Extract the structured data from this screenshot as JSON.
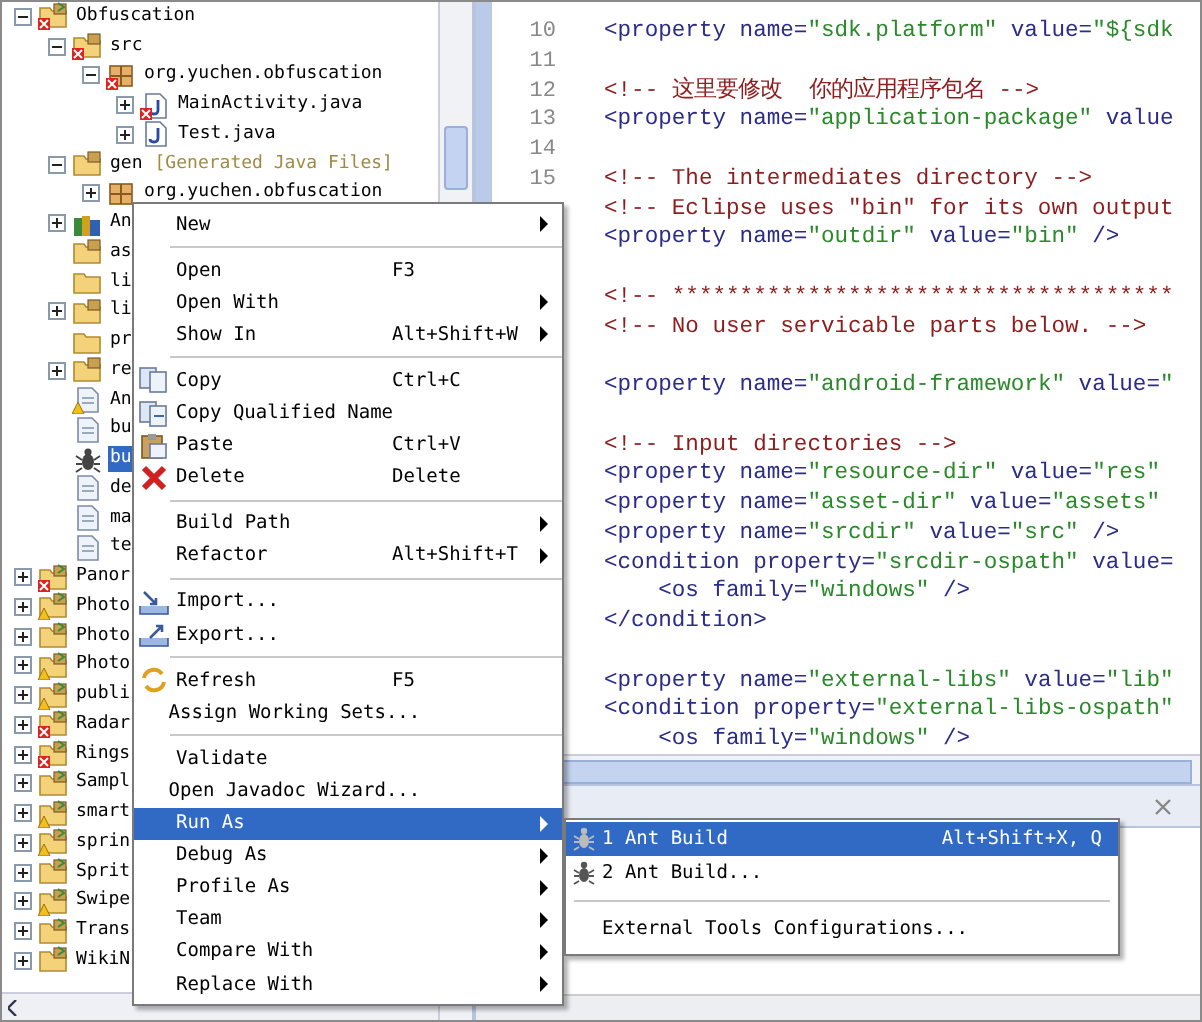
{
  "tree": [
    {
      "label": "Obfuscation",
      "kind": "project",
      "error": true,
      "warning": false,
      "selected": false,
      "expanded": true,
      "children": [
        {
          "label": "src",
          "kind": "source-folder",
          "error": true,
          "warning": false,
          "selected": false,
          "expanded": true,
          "children": [
            {
              "label": "org.yuchen.obfuscation",
              "kind": "package",
              "error": true,
              "warning": false,
              "selected": false,
              "expanded": true,
              "children": [
                {
                  "label": "MainActivity.java",
                  "kind": "java",
                  "error": true,
                  "warning": false,
                  "selected": false,
                  "expanded": false
                },
                {
                  "label": "Test.java",
                  "kind": "java",
                  "error": false,
                  "warning": false,
                  "selected": false,
                  "expanded": false
                }
              ]
            }
          ]
        },
        {
          "label": "gen",
          "decoration": "[Generated Java Files]",
          "kind": "source-folder",
          "error": false,
          "warning": false,
          "selected": false,
          "expanded": true,
          "children": [
            {
              "label": "org.yuchen.obfuscation",
              "kind": "package",
              "error": false,
              "warning": false,
              "selected": false,
              "expanded": false
            }
          ]
        },
        {
          "label": "An",
          "kind": "library",
          "error": false,
          "warning": false,
          "selected": false,
          "expanded": false
        },
        {
          "label": "as",
          "kind": "source-folder",
          "error": false,
          "warning": false,
          "selected": false
        },
        {
          "label": "li",
          "kind": "folder",
          "error": false,
          "warning": false,
          "selected": false
        },
        {
          "label": "li",
          "kind": "source-folder",
          "error": false,
          "warning": false,
          "selected": false,
          "expanded": false
        },
        {
          "label": "pr",
          "kind": "folder",
          "error": false,
          "warning": false,
          "selected": false
        },
        {
          "label": "re",
          "kind": "source-folder",
          "error": false,
          "warning": false,
          "selected": false,
          "expanded": false
        },
        {
          "label": "An",
          "kind": "manifest",
          "error": false,
          "warning": true,
          "selected": false
        },
        {
          "label": "bu",
          "kind": "file",
          "error": false,
          "warning": false,
          "selected": false
        },
        {
          "label": "bu",
          "kind": "ant",
          "error": false,
          "warning": false,
          "selected": true
        },
        {
          "label": "de",
          "kind": "file",
          "error": false,
          "warning": false,
          "selected": false
        },
        {
          "label": "ma",
          "kind": "file",
          "error": false,
          "warning": false,
          "selected": false
        },
        {
          "label": "te",
          "kind": "file",
          "error": false,
          "warning": false,
          "selected": false
        }
      ]
    },
    {
      "label": "Panor",
      "kind": "project",
      "error": true,
      "warning": false,
      "selected": false,
      "expanded": false
    },
    {
      "label": "Photo",
      "kind": "project",
      "error": false,
      "warning": true,
      "selected": false,
      "expanded": false
    },
    {
      "label": "Photo",
      "kind": "project",
      "error": false,
      "warning": false,
      "selected": false,
      "expanded": false
    },
    {
      "label": "Photo",
      "kind": "project",
      "error": false,
      "warning": true,
      "selected": false,
      "expanded": false
    },
    {
      "label": "publi",
      "kind": "project",
      "error": false,
      "warning": true,
      "selected": false,
      "expanded": false
    },
    {
      "label": "Radar",
      "kind": "project",
      "error": true,
      "warning": false,
      "selected": false,
      "expanded": false
    },
    {
      "label": "Rings",
      "kind": "project",
      "error": true,
      "warning": false,
      "selected": false,
      "expanded": false
    },
    {
      "label": "Sampl",
      "kind": "project",
      "error": false,
      "warning": false,
      "selected": false,
      "expanded": false
    },
    {
      "label": "smart",
      "kind": "project",
      "error": false,
      "warning": true,
      "selected": false,
      "expanded": false
    },
    {
      "label": "sprin",
      "kind": "project",
      "error": false,
      "warning": true,
      "selected": false,
      "expanded": false
    },
    {
      "label": "Sprit",
      "kind": "project",
      "error": false,
      "warning": false,
      "selected": false,
      "expanded": false
    },
    {
      "label": "Swipe",
      "kind": "project",
      "error": false,
      "warning": true,
      "selected": false,
      "expanded": false
    },
    {
      "label": "Trans",
      "kind": "project",
      "error": false,
      "warning": false,
      "selected": false,
      "expanded": false
    },
    {
      "label": "WikiN",
      "kind": "project",
      "error": false,
      "warning": false,
      "selected": false,
      "expanded": false
    }
  ],
  "editor": {
    "lines": [
      {
        "kind": "code",
        "number": "10",
        "segments": [
          {
            "kind": "markup",
            "text": "<property name="
          },
          {
            "kind": "value",
            "text": "\"sdk.platform\""
          },
          {
            "kind": "markup",
            "text": " value="
          },
          {
            "kind": "value",
            "text": "\"${sdk"
          }
        ]
      },
      {
        "kind": "blank",
        "number": "11"
      },
      {
        "kind": "code",
        "number": "12",
        "segments": [
          {
            "kind": "comment",
            "text": "<!-- 这里要修改  你的应用程序包名 -->"
          }
        ]
      },
      {
        "kind": "code",
        "number": "13",
        "segments": [
          {
            "kind": "markup",
            "text": "<property name="
          },
          {
            "kind": "value",
            "text": "\"application-package\""
          },
          {
            "kind": "markup",
            "text": " value"
          }
        ]
      },
      {
        "kind": "blank",
        "number": "14"
      },
      {
        "kind": "code",
        "number": "15",
        "segments": [
          {
            "kind": "comment",
            "text": "<!-- The intermediates directory -->"
          }
        ]
      },
      {
        "kind": "code",
        "segments": [
          {
            "kind": "comment",
            "text": "<!-- Eclipse uses \"bin\" for its own output"
          }
        ]
      },
      {
        "kind": "code",
        "segments": [
          {
            "kind": "markup",
            "text": "<property name="
          },
          {
            "kind": "value",
            "text": "\"outdir\""
          },
          {
            "kind": "markup",
            "text": " value="
          },
          {
            "kind": "value",
            "text": "\"bin\""
          },
          {
            "kind": "markup",
            "text": " />"
          }
        ]
      },
      {
        "kind": "blank"
      },
      {
        "kind": "code",
        "segments": [
          {
            "kind": "comment",
            "text": "<!-- *************************************"
          }
        ]
      },
      {
        "kind": "code",
        "segments": [
          {
            "kind": "comment",
            "text": "<!-- No user servicable parts below. -->"
          }
        ]
      },
      {
        "kind": "blank"
      },
      {
        "kind": "code",
        "segments": [
          {
            "kind": "markup",
            "text": "<property name="
          },
          {
            "kind": "value",
            "text": "\"android-framework\""
          },
          {
            "kind": "markup",
            "text": " value="
          },
          {
            "kind": "value",
            "text": "\""
          }
        ]
      },
      {
        "kind": "blank"
      },
      {
        "kind": "code",
        "segments": [
          {
            "kind": "comment",
            "text": "<!-- Input directories -->"
          }
        ]
      },
      {
        "kind": "code",
        "segments": [
          {
            "kind": "markup",
            "text": "<property name="
          },
          {
            "kind": "value",
            "text": "\"resource-dir\""
          },
          {
            "kind": "markup",
            "text": " value="
          },
          {
            "kind": "value",
            "text": "\"res\""
          }
        ]
      },
      {
        "kind": "code",
        "segments": [
          {
            "kind": "markup",
            "text": "<property name="
          },
          {
            "kind": "value",
            "text": "\"asset-dir\""
          },
          {
            "kind": "markup",
            "text": " value="
          },
          {
            "kind": "value",
            "text": "\"assets\""
          }
        ]
      },
      {
        "kind": "code",
        "segments": [
          {
            "kind": "markup",
            "text": "<property name="
          },
          {
            "kind": "value",
            "text": "\"srcdir\""
          },
          {
            "kind": "markup",
            "text": " value="
          },
          {
            "kind": "value",
            "text": "\"src\""
          },
          {
            "kind": "markup",
            "text": " />"
          }
        ]
      },
      {
        "kind": "code",
        "segments": [
          {
            "kind": "markup",
            "text": "<condition property="
          },
          {
            "kind": "value",
            "text": "\"srcdir-ospath\""
          },
          {
            "kind": "markup",
            "text": " value="
          }
        ]
      },
      {
        "kind": "code",
        "segments": [
          {
            "kind": "markup",
            "text": "    <os family="
          },
          {
            "kind": "value",
            "text": "\"windows\""
          },
          {
            "kind": "markup",
            "text": " />"
          }
        ]
      },
      {
        "kind": "code",
        "segments": [
          {
            "kind": "markup",
            "text": "</condition>"
          }
        ]
      },
      {
        "kind": "blank"
      },
      {
        "kind": "code",
        "segments": [
          {
            "kind": "markup",
            "text": "<property name="
          },
          {
            "kind": "value",
            "text": "\"external-libs\""
          },
          {
            "kind": "markup",
            "text": " value="
          },
          {
            "kind": "value",
            "text": "\"lib\""
          }
        ]
      },
      {
        "kind": "code",
        "segments": [
          {
            "kind": "markup",
            "text": "<condition property="
          },
          {
            "kind": "value",
            "text": "\"external-libs-ospath\""
          }
        ]
      },
      {
        "kind": "code",
        "segments": [
          {
            "kind": "markup",
            "text": "    <os family="
          },
          {
            "kind": "value",
            "text": "\"windows\""
          },
          {
            "kind": "markup",
            "text": " />"
          }
        ]
      }
    ]
  },
  "menu": {
    "items": [
      {
        "kind": "item",
        "label": "New",
        "submenu": true,
        "selected": false
      },
      {
        "kind": "separator"
      },
      {
        "kind": "item",
        "label": "Open",
        "shortcut": "F3",
        "submenu": false,
        "selected": false
      },
      {
        "kind": "item",
        "label": "Open With",
        "submenu": true,
        "selected": false
      },
      {
        "kind": "item",
        "label": "Show In",
        "shortcut": "Alt+Shift+W",
        "submenu": true,
        "selected": false
      },
      {
        "kind": "separator"
      },
      {
        "kind": "copy",
        "label": "Copy",
        "shortcut": "Ctrl+C",
        "submenu": false,
        "selected": false
      },
      {
        "kind": "copy-qualified",
        "label": "Copy Qualified Name",
        "submenu": false,
        "selected": false
      },
      {
        "kind": "paste",
        "label": "Paste",
        "shortcut": "Ctrl+V",
        "submenu": false,
        "selected": false
      },
      {
        "kind": "delete",
        "label": "Delete",
        "shortcut": "Delete",
        "submenu": false,
        "selected": false
      },
      {
        "kind": "separator"
      },
      {
        "kind": "item",
        "label": "Build Path",
        "submenu": true,
        "selected": false
      },
      {
        "kind": "item",
        "label": "Refactor",
        "shortcut": "Alt+Shift+T",
        "submenu": true,
        "selected": false
      },
      {
        "kind": "separator"
      },
      {
        "kind": "import",
        "label": "Import...",
        "submenu": false,
        "selected": false
      },
      {
        "kind": "export",
        "label": "Export...",
        "submenu": false,
        "selected": false
      },
      {
        "kind": "separator"
      },
      {
        "kind": "refresh",
        "label": "Refresh",
        "shortcut": "F5",
        "submenu": false,
        "selected": false
      },
      {
        "kind": "item",
        "label": "Assign Working Sets...",
        "submenu": false,
        "selected": false
      },
      {
        "kind": "separator"
      },
      {
        "kind": "item",
        "label": "Validate",
        "submenu": false,
        "selected": false
      },
      {
        "kind": "item",
        "label": "Open Javadoc Wizard...",
        "submenu": false,
        "selected": false
      },
      {
        "kind": "item",
        "label": "Run As",
        "submenu": true,
        "selected": true
      },
      {
        "kind": "item",
        "label": "Debug As",
        "submenu": true,
        "selected": false
      },
      {
        "kind": "item",
        "label": "Profile As",
        "submenu": true,
        "selected": false
      },
      {
        "kind": "item",
        "label": "Team",
        "submenu": true,
        "selected": false
      },
      {
        "kind": "item",
        "label": "Compare With",
        "submenu": true,
        "selected": false
      },
      {
        "kind": "item",
        "label": "Replace With",
        "submenu": true,
        "selected": false
      }
    ]
  },
  "submenu": {
    "items": [
      {
        "kind": "ant",
        "label": "1 Ant Build",
        "shortcut": "Alt+Shift+X, Q",
        "selected": true
      },
      {
        "kind": "ant-config",
        "label": "2 Ant Build...",
        "selected": false
      },
      {
        "kind": "separator"
      },
      {
        "kind": "item",
        "label": "External Tools Configurations...",
        "selected": false
      }
    ]
  }
}
